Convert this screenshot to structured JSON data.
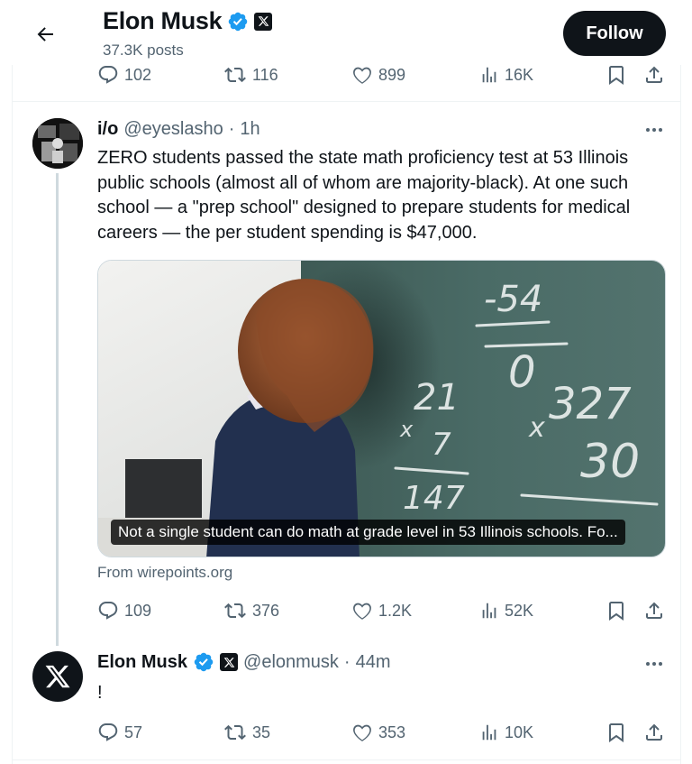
{
  "header": {
    "name": "Elon Musk",
    "posts": "37.3K posts",
    "follow_label": "Follow"
  },
  "prev_tweet": {
    "stats": {
      "replies": "102",
      "retweets": "116",
      "likes": "899",
      "views": "16K"
    }
  },
  "tweet1": {
    "name": "i/o",
    "handle": "@eyeslasho",
    "dot": "·",
    "time": "1h",
    "text": "ZERO students passed the state math proficiency test at 53 Illinois public schools (almost all of whom are majority-black). At one such school — a \"prep school\" designed to prepare students for medical careers — the per student spending is $47,000.",
    "media_caption": "Not a single student can do math at grade level in 53 Illinois schools. Fo...",
    "source": "From wirepoints.org",
    "chalkboard": [
      "-54",
      "0",
      "327",
      "x",
      "30",
      "21",
      "x",
      "7",
      "147"
    ],
    "stats": {
      "replies": "109",
      "retweets": "376",
      "likes": "1.2K",
      "views": "52K"
    }
  },
  "tweet2": {
    "name": "Elon Musk",
    "handle": "@elonmusk",
    "dot": "·",
    "time": "44m",
    "text": "!",
    "stats": {
      "replies": "57",
      "retweets": "35",
      "likes": "353",
      "views": "10K"
    }
  },
  "colors": {
    "verified": "#1d9bf0",
    "text": "#0f1419",
    "secondary": "#536471",
    "border": "#eff3f4"
  },
  "icons": [
    "back-arrow-icon",
    "verified-badge-icon",
    "x-logo-icon",
    "reply-icon",
    "retweet-icon",
    "like-icon",
    "views-icon",
    "bookmark-icon",
    "share-icon",
    "more-icon"
  ]
}
